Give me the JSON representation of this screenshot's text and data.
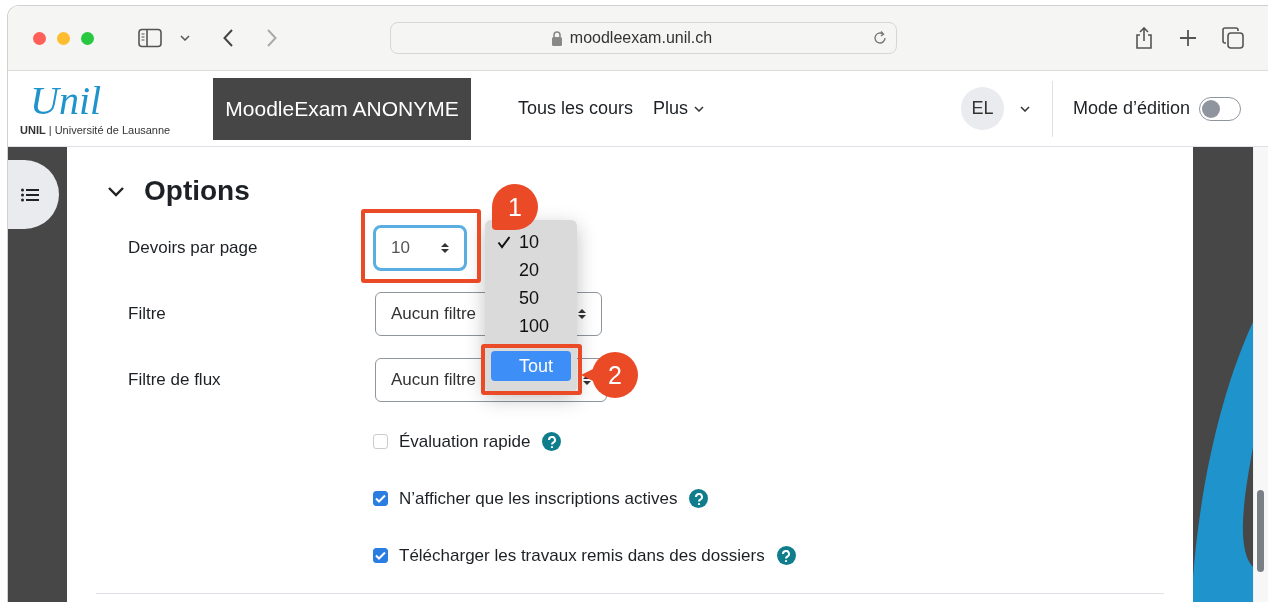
{
  "browser": {
    "url": "moodleexam.unil.ch"
  },
  "header": {
    "logo_text": "Unil",
    "logo_caption": "**UNIL** | Université de Lausanne",
    "site_name": "MoodleExam ANONYME",
    "nav": [
      {
        "label": "Tous les cours",
        "has_menu": false
      },
      {
        "label": "Plus",
        "has_menu": true
      }
    ],
    "avatar": "EL",
    "edit_mode": {
      "label": "Mode d’édition",
      "on": false
    }
  },
  "section": {
    "title": "Options",
    "expanded": true,
    "selects": [
      {
        "label": "Devoirs par page",
        "value": "10",
        "focused": true
      },
      {
        "label": "Filtre",
        "value": "Aucun filtre",
        "focused": false
      },
      {
        "label": "Filtre de flux",
        "value": "Aucun filtre",
        "focused": false
      }
    ],
    "dropdown": {
      "options": [
        {
          "label": "10",
          "checked": true,
          "selected": false
        },
        {
          "label": "20",
          "checked": false,
          "selected": false
        },
        {
          "label": "50",
          "checked": false,
          "selected": false
        },
        {
          "label": "100",
          "checked": false,
          "selected": false
        },
        {
          "label": "Tout",
          "checked": false,
          "selected": true
        }
      ]
    },
    "checkboxes": [
      {
        "label": "Évaluation rapide",
        "checked": false
      },
      {
        "label": "N’afficher que les inscriptions actives",
        "checked": true
      },
      {
        "label": "Télécharger les travaux remis dans des dossiers",
        "checked": true
      }
    ]
  },
  "annotations": [
    {
      "number": "1"
    },
    {
      "number": "2"
    }
  ]
}
